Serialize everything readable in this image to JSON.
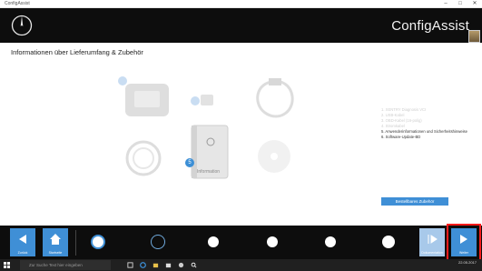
{
  "window": {
    "title": "ConfigAssist",
    "minimize": "–",
    "maximize": "□",
    "close": "✕"
  },
  "header": {
    "brand": "ConfigAssist"
  },
  "page": {
    "title": "Informationen über Lieferumfang & Zubehör"
  },
  "illustration": {
    "active_step_number": "5",
    "document_label": "Information"
  },
  "steps": [
    "1. XENTRY Diagnosis VCI",
    "2. USB-Kabel",
    "3. OBD-Kabel (16-polig)",
    "4. Stromkabel",
    "5. Anwenderinformationen und Sicherheitshinweise",
    "6. Software-Update-BD"
  ],
  "active_step_index": 4,
  "accessories_button": "Bestellbares Zubehör",
  "toolbar": {
    "back_label": "Zurück",
    "home_label": "Startseite",
    "docs_label": "Dokumentation",
    "next_label": "Weiter"
  },
  "taskbar": {
    "search_placeholder": "Zur Suche Text hier eingeben",
    "time": "",
    "date": "22.05.2017"
  },
  "colors": {
    "accent": "#3f8fd6",
    "header_bg": "#0d0d0d",
    "highlight": "#ff1a1a"
  }
}
